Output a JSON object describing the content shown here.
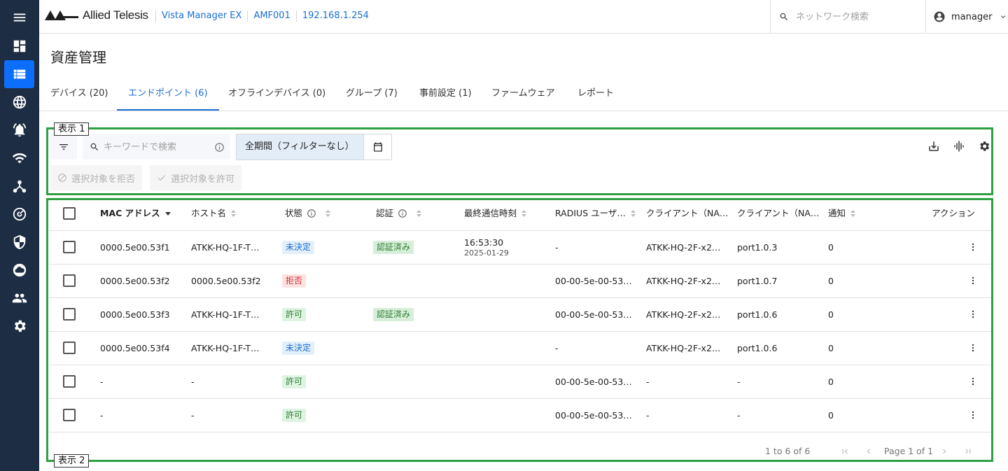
{
  "header": {
    "brand": "Allied Telesis",
    "breadcrumbs": [
      "Vista Manager EX",
      "AMF001",
      "192.168.1.254"
    ],
    "search_placeholder": "ネットワーク検索",
    "user": "manager"
  },
  "sidebar": {
    "items": [
      {
        "icon": "dashboard-icon",
        "active": false
      },
      {
        "icon": "asset-list-icon",
        "active": true
      },
      {
        "icon": "globe-icon",
        "active": false
      },
      {
        "icon": "alarm-bell-icon",
        "active": false
      },
      {
        "icon": "wifi-icon",
        "active": false
      },
      {
        "icon": "topology-icon",
        "active": false
      },
      {
        "icon": "radar-icon",
        "active": false
      },
      {
        "icon": "security-shield-icon",
        "active": false
      },
      {
        "icon": "cloud-icon",
        "active": false
      },
      {
        "icon": "users-icon",
        "active": false
      },
      {
        "icon": "settings-gear-icon",
        "active": false
      }
    ]
  },
  "page": {
    "title": "資産管理",
    "tabs": [
      {
        "label": "デバイス (20)",
        "active": false
      },
      {
        "label": "エンドポイント (6)",
        "active": true
      },
      {
        "label": "オフラインデバイス (0)",
        "active": false
      },
      {
        "label": "グループ (7)",
        "active": false
      },
      {
        "label": "事前設定 (1)",
        "active": false
      },
      {
        "label": "ファームウェア",
        "active": false
      },
      {
        "label": "レポート",
        "active": false
      }
    ]
  },
  "annotations": {
    "box1_label": "表示 1",
    "box2_label": "表示 2",
    "color": "#2ea043"
  },
  "toolbar": {
    "keyword_placeholder": "キーワードで検索",
    "period_label": "全期間（フィルターなし）",
    "deny_selected": "選択対象を拒否",
    "allow_selected": "選択対象を許可"
  },
  "table": {
    "columns": [
      "MAC アドレス",
      "ホスト名",
      "状態",
      "認証",
      "最終通信時刻",
      "RADIUS ユーザ…",
      "クライアント（NA…",
      "クライアント（NA…",
      "通知",
      "アクション"
    ],
    "rows": [
      {
        "mac": "0000.5e00.53f1",
        "host": "ATKK-HQ-1F-T…",
        "status": "未決定",
        "status_type": "pending",
        "auth": "認証済み",
        "last_time": "16:53:30",
        "last_date": "2025-01-29",
        "radius": "-",
        "client1": "ATKK-HQ-2F-x2…",
        "client2": "port1.0.3",
        "notify": "0"
      },
      {
        "mac": "0000.5e00.53f2",
        "host": "0000.5e00.53f2",
        "status": "拒否",
        "status_type": "deny",
        "auth": "",
        "last_time": "",
        "last_date": "",
        "radius": "00-00-5e-00-53…",
        "client1": "ATKK-HQ-2F-x2…",
        "client2": "port1.0.7",
        "notify": "0"
      },
      {
        "mac": "0000.5e00.53f3",
        "host": "ATKK-HQ-1F-T…",
        "status": "許可",
        "status_type": "ok",
        "auth": "認証済み",
        "last_time": "",
        "last_date": "",
        "radius": "00-00-5e-00-53…",
        "client1": "ATKK-HQ-2F-x2…",
        "client2": "port1.0.6",
        "notify": "0"
      },
      {
        "mac": "0000.5e00.53f4",
        "host": "ATKK-HQ-1F-T…",
        "status": "未決定",
        "status_type": "pending",
        "auth": "",
        "last_time": "",
        "last_date": "",
        "radius": "-",
        "client1": "ATKK-HQ-2F-x2…",
        "client2": "port1.0.6",
        "notify": "0"
      },
      {
        "mac": "-",
        "host": "-",
        "status": "許可",
        "status_type": "ok",
        "auth": "",
        "last_time": "",
        "last_date": "",
        "radius": "00-00-5e-00-53…",
        "client1": "-",
        "client2": "-",
        "notify": "0"
      },
      {
        "mac": "-",
        "host": "-",
        "status": "許可",
        "status_type": "ok",
        "auth": "",
        "last_time": "",
        "last_date": "",
        "radius": "00-00-5e-00-53…",
        "client1": "-",
        "client2": "-",
        "notify": "0"
      }
    ]
  },
  "pagination": {
    "range": "1 to 6 of 6",
    "page": "Page 1 of 1"
  }
}
